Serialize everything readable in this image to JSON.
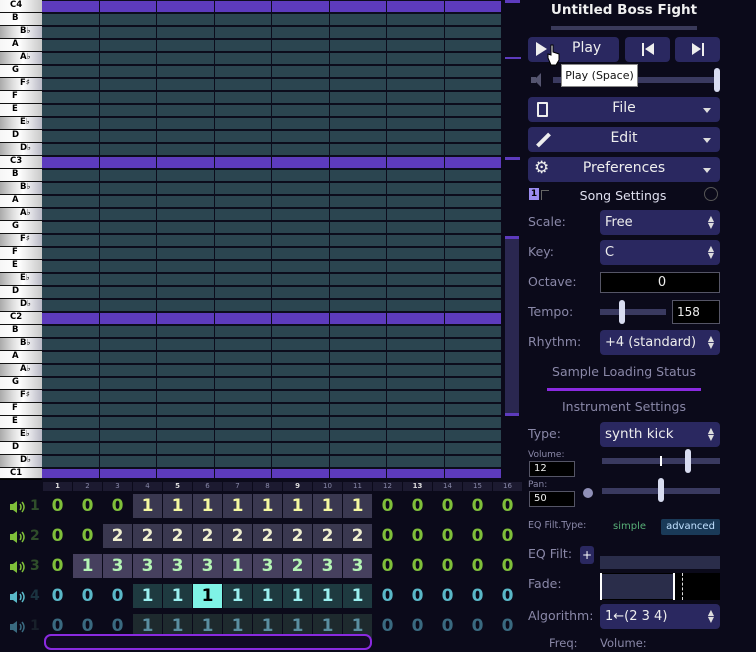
{
  "piano": {
    "keys": [
      "C4",
      "B",
      "B♭",
      "A",
      "A♭",
      "G",
      "F♯",
      "F",
      "E",
      "E♭",
      "D",
      "D♭",
      "C3",
      "B",
      "B♭",
      "A",
      "A♭",
      "G",
      "F♯",
      "F",
      "E",
      "E♭",
      "D",
      "D♭",
      "C2",
      "B",
      "B♭",
      "A",
      "A♭",
      "G",
      "F♯",
      "F",
      "E",
      "E♭",
      "D",
      "D♭",
      "C1"
    ]
  },
  "ruler": [
    "1",
    "2",
    "3",
    "4",
    "5",
    "6",
    "7",
    "8",
    "9",
    "10",
    "11",
    "12",
    "13",
    "14",
    "15",
    "16"
  ],
  "channels": [
    {
      "label": "1",
      "patterns": [
        "0",
        "0",
        "0",
        "1",
        "1",
        "1",
        "1",
        "1",
        "1",
        "1",
        "1",
        "0",
        "0",
        "0",
        "0",
        "0"
      ]
    },
    {
      "label": "2",
      "patterns": [
        "0",
        "0",
        "2",
        "2",
        "2",
        "2",
        "2",
        "2",
        "2",
        "2",
        "2",
        "0",
        "0",
        "0",
        "0",
        "0"
      ]
    },
    {
      "label": "3",
      "patterns": [
        "0",
        "1",
        "3",
        "3",
        "3",
        "3",
        "1",
        "3",
        "2",
        "3",
        "3",
        "0",
        "0",
        "0",
        "0",
        "0"
      ]
    },
    {
      "label": "4",
      "patterns": [
        "0",
        "0",
        "0",
        "1",
        "1",
        "1",
        "1",
        "1",
        "1",
        "1",
        "1",
        "0",
        "0",
        "0",
        "0",
        "0"
      ]
    },
    {
      "label": "1",
      "patterns": [
        "0",
        "0",
        "0",
        "1",
        "1",
        "1",
        "1",
        "1",
        "1",
        "1",
        "1",
        "0",
        "0",
        "0",
        "0",
        "0"
      ]
    }
  ],
  "side": {
    "title": "Untitled Boss Fight",
    "play_label": "Play",
    "tooltip": "Play (Space)",
    "file_label": "File",
    "edit_label": "Edit",
    "preferences_label": "Preferences",
    "song_settings_badge": "1",
    "song_settings": "Song Settings",
    "scale_label": "Scale:",
    "scale_value": "Free",
    "key_label": "Key:",
    "key_value": "C",
    "octave_label": "Octave:",
    "octave_value": "0",
    "tempo_label": "Tempo:",
    "tempo_value": "158",
    "rhythm_label": "Rhythm:",
    "rhythm_value": "+4 (standard)",
    "sample_status": "Sample Loading Status",
    "instrument_settings": "Instrument Settings",
    "type_label": "Type:",
    "type_value": "synth kick",
    "volume_label": "Volume:",
    "volume_value": "12",
    "pan_label": "Pan:",
    "pan_value": "50",
    "eq_type_label": "EQ Filt.Type:",
    "eq_simple": "simple",
    "eq_advanced": "advanced",
    "eq_filt_label": "EQ Filt:",
    "eq_add": "+",
    "fade_label": "Fade:",
    "algorithm_label": "Algorithm:",
    "algorithm_value": "1←(2 3 4)",
    "freq_label": "Freq:",
    "volume2_label": "Volume:"
  },
  "colors": {
    "accent": "#5d3bbd",
    "note_cell": "#2b4550",
    "panel_button": "#2a2860",
    "selected_pattern": "#7ff3e6"
  }
}
